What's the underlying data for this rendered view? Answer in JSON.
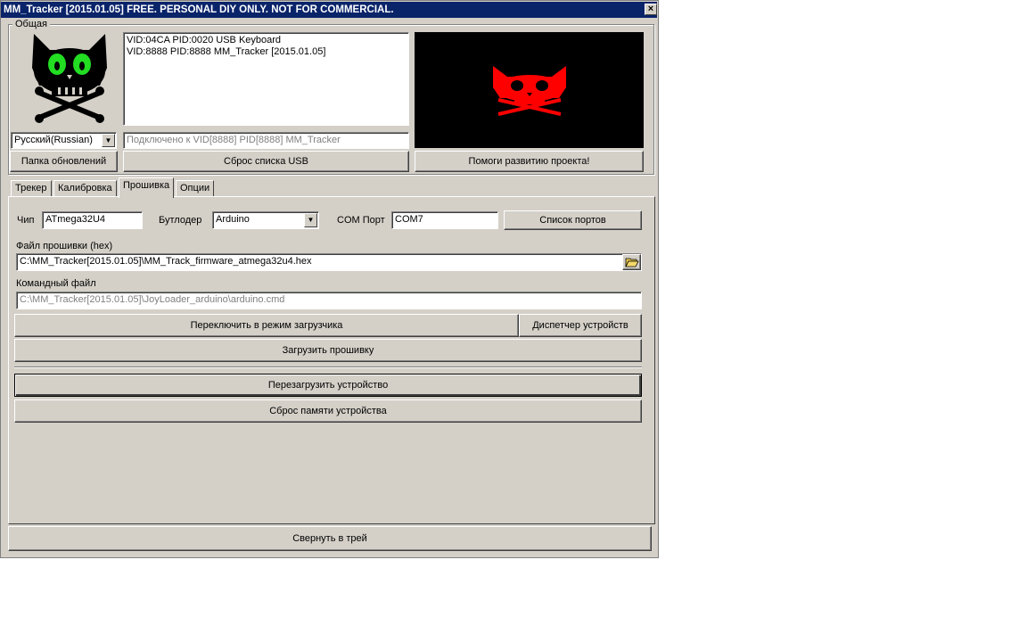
{
  "title": "MM_Tracker [2015.01.05] FREE. PERSONAL DIY ONLY. NOT FOR COMMERCIAL.",
  "close_glyph": "×",
  "general": {
    "group_label": "Общая",
    "usb_devices": [
      "VID:04CA PID:0020 USB Keyboard",
      "VID:8888 PID:8888 MM_Tracker [2015.01.05]"
    ],
    "language": "Русский(Russian)",
    "connection_status": "Подключено к VID[8888] PID[8888] MM_Tracker",
    "updates_folder_button": "Папка обновлений",
    "reset_usb_button": "Сброс списка USB",
    "support_button": "Помоги развитию проекта!"
  },
  "tabs": [
    "Трекер",
    "Калибровка",
    "Прошивка",
    "Опции"
  ],
  "active_tab": "Прошивка",
  "firmware": {
    "chip_label": "Чип",
    "chip_value": "ATmega32U4",
    "bootloader_label": "Бутлодер",
    "bootloader_value": "Arduino",
    "com_label": "COM Порт",
    "com_value": "COM7",
    "port_list_button": "Список портов",
    "hex_label": "Файл прошивки (hex)",
    "hex_path": "C:\\MM_Tracker[2015.01.05]\\MM_Track_firmware_atmega32u4.hex",
    "cmd_label": "Командный файл",
    "cmd_path": "C:\\MM_Tracker[2015.01.05]\\JoyLoader_arduino\\arduino.cmd",
    "bootloader_mode_button": "Переключить в режим загрузчика",
    "device_manager_button": "Диспетчер устройств",
    "upload_button": "Загрузить прошивку",
    "reboot_button": "Перезагрузить устройство",
    "reset_memory_button": "Сброс памяти устройства"
  },
  "tray_button": "Свернуть в трей",
  "colors": {
    "titlebar": "#0a246a",
    "window_face": "#d4d0c8",
    "logo_eyes": "#22dd22",
    "preview_skull": "#ff0000",
    "preview_bg": "#000000"
  },
  "icons": {
    "logo": "cat-skull-crossbones-icon",
    "preview": "red-cat-skull-icon",
    "browse": "folder-open-icon",
    "combo": "chevron-down-icon"
  }
}
